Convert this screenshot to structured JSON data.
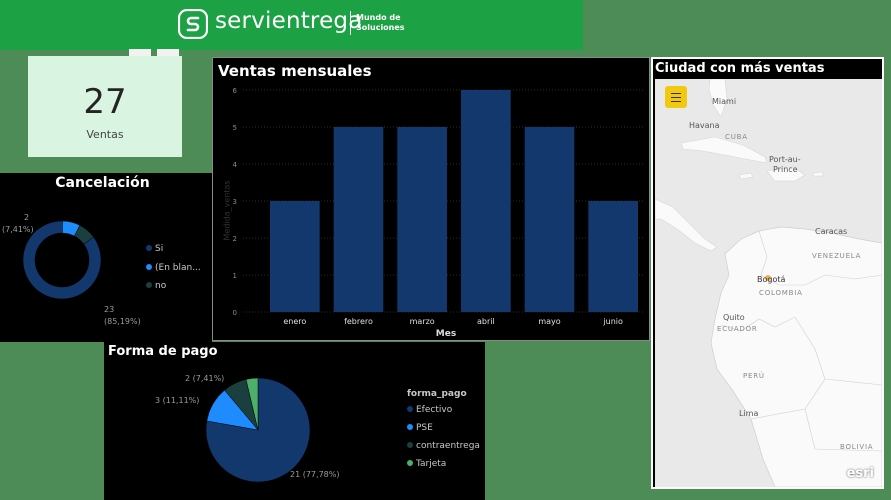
{
  "header": {
    "brand": "servientrega",
    "tagline_line1": "Mundo de",
    "tagline_line2": "Soluciones",
    "logo_icon": "servientrega-s-logo-icon"
  },
  "kpi": {
    "value": "27",
    "label": "Ventas"
  },
  "cancelacion": {
    "title": "Cancelación",
    "legend": [
      {
        "label": "Si",
        "color": "#12386e"
      },
      {
        "label": "(En blan...",
        "color": "#1e8cff"
      },
      {
        "label": "no",
        "color": "#1b3e3f"
      }
    ],
    "labels": {
      "si": "23",
      "si_pct": "(85,19%)",
      "blank": "2",
      "blank_pct": "(7,41%)"
    },
    "chart_data": {
      "type": "pie",
      "categories": [
        "Si",
        "(En blan...",
        "no"
      ],
      "values": [
        23,
        2,
        2
      ],
      "percentages": [
        "85,19%",
        "7,41%",
        "7,41%"
      ],
      "colors": [
        "#12386e",
        "#1e8cff",
        "#1b3e3f"
      ],
      "donut": true
    }
  },
  "forma_pago": {
    "title": "Forma de pago",
    "legend_title": "forma_pago",
    "legend": [
      {
        "label": "Efectivo",
        "color": "#12386e"
      },
      {
        "label": "PSE",
        "color": "#1e8cff"
      },
      {
        "label": "contraentrega",
        "color": "#1b3e3f"
      },
      {
        "label": "Tarjeta",
        "color": "#4caf6a"
      }
    ],
    "labels": {
      "efectivo": "21 (77,78%)",
      "pse": "3 (11,11%)",
      "contra": "2 (7,41%)",
      "tarjeta": "1"
    },
    "chart_data": {
      "type": "pie",
      "categories": [
        "Efectivo",
        "PSE",
        "contraentrega",
        "Tarjeta"
      ],
      "values": [
        21,
        3,
        2,
        1
      ],
      "colors": [
        "#12386e",
        "#1e8cff",
        "#1b3e3f",
        "#4caf6a"
      ]
    }
  },
  "ventas": {
    "title": "Ventas mensuales",
    "ylabel": "Medida_ventas",
    "xlabel": "Mes",
    "chart_data": {
      "type": "bar",
      "categories": [
        "enero",
        "febrero",
        "marzo",
        "abril",
        "mayo",
        "junio"
      ],
      "values": [
        3,
        5,
        5,
        6,
        5,
        3
      ],
      "ylim": [
        0,
        6
      ],
      "yticks": [
        "0",
        "1",
        "2",
        "3",
        "4",
        "5",
        "6"
      ],
      "grid": true,
      "color": "#12386e"
    }
  },
  "mapa": {
    "title": "Ciudad con más ventas",
    "cities": {
      "miami": "Miami",
      "havana": "Havana",
      "cuba": "CUBA",
      "port": "Port-au-",
      "port2": "Prince",
      "caracas": "Caracas",
      "venezuela": "VENEZUELA",
      "bogota": "Bogotá",
      "colombia": "COLOMBIA",
      "quito": "Quito",
      "ecuador": "ECUADOR",
      "peru": "PERÚ",
      "lima": "Lima",
      "bolivia": "BOLIVIA"
    },
    "attribution": "esri",
    "menu_icon": "hamburger-menu-icon"
  }
}
